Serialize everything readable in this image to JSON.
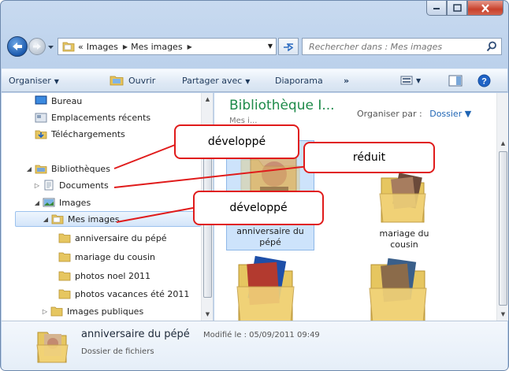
{
  "window": {
    "caption_buttons": [
      "minimize-icon",
      "maximize-icon",
      "close-icon"
    ]
  },
  "navbar": {
    "breadcrumb": {
      "overflow": "«",
      "items": [
        "Images",
        "Mes images"
      ]
    },
    "search_placeholder": "Rechercher dans : Mes images"
  },
  "toolbar": {
    "organiser": "Organiser",
    "ouvrir": "Ouvrir",
    "partager": "Partager avec",
    "diaporama": "Diaporama",
    "more": "»"
  },
  "nav_pane": {
    "items": [
      {
        "label": "Bureau",
        "icon": "desktop-icon"
      },
      {
        "label": "Emplacements récents",
        "icon": "recent-places-icon"
      },
      {
        "label": "Téléchargements",
        "icon": "downloads-icon"
      },
      {
        "label": "Bibliothèques",
        "icon": "libraries-icon",
        "state": "expanded"
      },
      {
        "label": "Documents",
        "icon": "documents-icon",
        "state": "collapsed"
      },
      {
        "label": "Images",
        "icon": "pictures-icon",
        "state": "expanded"
      },
      {
        "label": "Mes images",
        "icon": "folder-icon",
        "state": "expanded",
        "selected": true
      },
      {
        "label": "anniversaire du pépé",
        "icon": "folder-icon"
      },
      {
        "label": "mariage du cousin",
        "icon": "folder-icon"
      },
      {
        "label": "photos noel 2011",
        "icon": "folder-icon"
      },
      {
        "label": "photos vacances été 2011",
        "icon": "folder-icon"
      },
      {
        "label": "Images publiques",
        "icon": "folder-icon",
        "state": "collapsed"
      }
    ]
  },
  "main_pane": {
    "library_title": "Bibliothèque I...",
    "library_subtitle": "Mes i...",
    "arrange_label": "Organiser par :",
    "arrange_value": "Dossier",
    "tiles": [
      {
        "line1": "anniversaire du",
        "line2": "pépé",
        "selected": true
      },
      {
        "line1": "mariage du",
        "line2": "cousin"
      },
      {
        "line1": "",
        "line2": ""
      },
      {
        "line1": "",
        "line2": ""
      }
    ]
  },
  "details": {
    "name": "anniversaire du pépé",
    "modified": "Modifié le : 05/09/2011 09:49",
    "type": "Dossier de fichiers"
  },
  "callouts": {
    "developpe_1": "développé",
    "reduit": "réduit",
    "developpe_2": "développé"
  },
  "colors": {
    "callout_border": "#e01b1b",
    "library_title": "#1d8a49",
    "selection": "#cde3fb"
  }
}
